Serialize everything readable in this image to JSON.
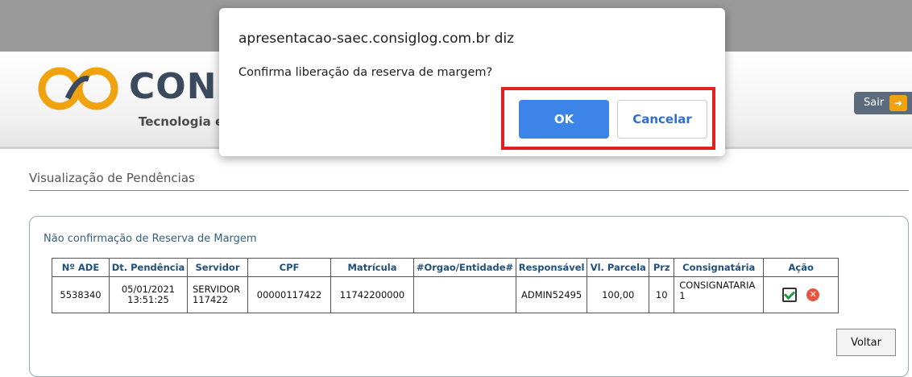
{
  "header": {
    "brand": "CONSI",
    "tagline": "Tecnologia e",
    "logout_label": "Sair",
    "logout_icon": "logout-arrow-icon"
  },
  "page": {
    "title": "Visualização de Pendências"
  },
  "panel": {
    "title": "Não confirmação de Reserva de Margem",
    "columns": [
      "Nº ADE",
      "Dt. Pendência",
      "Servidor",
      "CPF",
      "Matrícula",
      "#Orgao/Entidade#",
      "Responsável",
      "Vl. Parcela",
      "Prz",
      "Consignatária",
      "Ação"
    ],
    "rows": [
      {
        "ade": "5538340",
        "date": "05/01/2021",
        "time": "13:51:25",
        "servidor_1": "SERVIDOR",
        "servidor_2": "117422",
        "cpf": "00000117422",
        "matricula": "11742200000",
        "orgao": "",
        "responsavel": "ADMIN52495",
        "parcela": "100,00",
        "prazo": "10",
        "consig_1": "CONSIGNATARIA",
        "consig_2": "1",
        "actions": [
          "confirm-check-icon",
          "cancel-x-icon"
        ]
      }
    ],
    "back_label": "Voltar"
  },
  "dialog": {
    "origin": "apresentacao-saec.consiglog.com.br diz",
    "message": "Confirma liberação da reserva de margem?",
    "ok_label": "OK",
    "cancel_label": "Cancelar",
    "highlight_color": "#e02020"
  },
  "colors": {
    "topbar": "#9a9a9a",
    "ok_button": "#3c84e8",
    "header_text": "#1f4f7a",
    "logo_orange": "#f0a20f"
  }
}
